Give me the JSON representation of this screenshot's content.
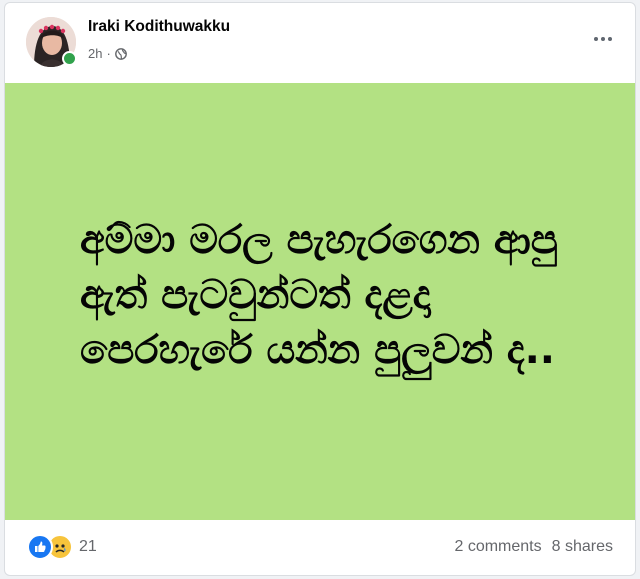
{
  "post": {
    "author": "Iraki Kodithuwakku",
    "time": "2h",
    "separator": "·",
    "audience_icon": "globe-icon",
    "more_icon": "more-options-icon",
    "background_color": "#b3e183",
    "text": "අම්මා මරල පැහැරගෙන ආපු ඇත් පැටවුන්ටත් දළදා පෙරහැරේ යන්න පුලුවන් ද.."
  },
  "stats": {
    "reaction_icons": [
      "like-icon",
      "sad-icon"
    ],
    "reaction_count": "21",
    "comments": "2 comments",
    "shares": "8 shares"
  }
}
